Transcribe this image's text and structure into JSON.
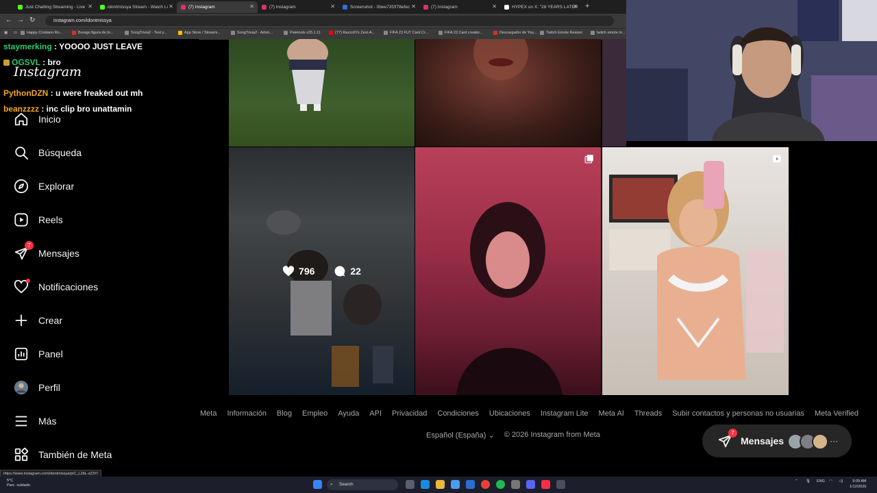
{
  "browser": {
    "tabs": [
      {
        "title": "Just Chatting Streaming - Live",
        "color": "#53fc18",
        "active": false
      },
      {
        "title": "idontmissya Stream - Watch Li",
        "color": "#53fc18",
        "active": false
      },
      {
        "title": "(7) Instagram",
        "color": "#e1306c",
        "active": true
      },
      {
        "title": "(7) Instagram",
        "color": "#e1306c",
        "active": false
      },
      {
        "title": "Screenshot - 0bee73f2f78efec",
        "color": "#2f6fde",
        "active": false
      },
      {
        "title": "(7) Instagram",
        "color": "#e1306c",
        "active": false
      },
      {
        "title": "HYPEX on X: \"28 YEARS LATER",
        "color": "#ffffff",
        "active": false
      }
    ],
    "url": "instagram.com/idontmissya",
    "bookmarks": [
      {
        "label": "Happy Cristiano Ro...",
        "color": "#888"
      },
      {
        "label": "Burago figura de to...",
        "color": "#d93025"
      },
      {
        "label": "SongTrivia2 - Test y...",
        "color": "#888"
      },
      {
        "label": "App Store / Streami...",
        "color": "#fbbc04"
      },
      {
        "label": "SongTrivia2 - Advin...",
        "color": "#888"
      },
      {
        "label": "Paletools v25.1.11",
        "color": "#888"
      },
      {
        "label": "(77) Razzo97s Zest-A...",
        "color": "#ff0000"
      },
      {
        "label": "FIFA 23 FUT Card Cr...",
        "color": "#888"
      },
      {
        "label": "FIFA 23 Card creator...",
        "color": "#888"
      },
      {
        "label": "Descargador de You...",
        "color": "#d93025"
      },
      {
        "label": "Twitch Emote Resizer",
        "color": "#888"
      },
      {
        "label": "twitch emote m...",
        "color": "#888"
      }
    ],
    "status_url": "https://www.instagram.com/idontmissya/p/C_LZbL-sZ3Y/"
  },
  "chat": [
    {
      "user": "staymerking",
      "user_color": "#2ecc71",
      "message": " : YOOOO JUST LEAVE",
      "badge": false
    },
    {
      "user": "OGSVL",
      "user_color": "#2ecc71",
      "message": " : bro",
      "badge": true
    },
    {
      "user": "PythonDZN",
      "user_color": "#f5a623",
      "message": " : u were freaked out mh",
      "badge": false
    },
    {
      "user": "beanzzzz",
      "user_color": "#f5a623",
      "message": " : inc clip bro unattamin",
      "badge": false
    }
  ],
  "sidebar": {
    "logo": "Instagram",
    "items": [
      {
        "label": "Inicio",
        "icon": "home-icon"
      },
      {
        "label": "Búsqueda",
        "icon": "search-icon"
      },
      {
        "label": "Explorar",
        "icon": "compass-icon"
      },
      {
        "label": "Reels",
        "icon": "reels-icon"
      },
      {
        "label": "Mensajes",
        "icon": "messenger-icon",
        "badge": "7"
      },
      {
        "label": "Notificaciones",
        "icon": "heart-icon"
      },
      {
        "label": "Crear",
        "icon": "plus-icon"
      },
      {
        "label": "Panel",
        "icon": "dashboard-icon"
      },
      {
        "label": "Perfil",
        "icon": "profile-avatar-icon"
      },
      {
        "label": "Más",
        "icon": "menu-icon"
      },
      {
        "label": "También de Meta",
        "icon": "meta-apps-icon"
      }
    ]
  },
  "post_overlay": {
    "likes": "796",
    "comments": "22"
  },
  "footer": {
    "links": [
      "Meta",
      "Información",
      "Blog",
      "Empleo",
      "Ayuda",
      "API",
      "Privacidad",
      "Condiciones",
      "Ubicaciones",
      "Instagram Lite",
      "Meta AI",
      "Threads",
      "Subir contactos y personas no usuarias",
      "Meta Verified"
    ],
    "language": "Español (España)",
    "copyright": "© 2026 Instagram from Meta"
  },
  "messages_pill": {
    "label": "Mensajes",
    "badge": "7"
  },
  "taskbar": {
    "weather_temp": "5°C",
    "weather_desc": "Parc. nublado",
    "search": "Search",
    "lang": "ENG",
    "time": "9:09 AM",
    "date": "1/12/2026"
  },
  "colors": {
    "accent": "#ff3040",
    "background": "#000000",
    "muted_text": "#a8a8a8"
  }
}
